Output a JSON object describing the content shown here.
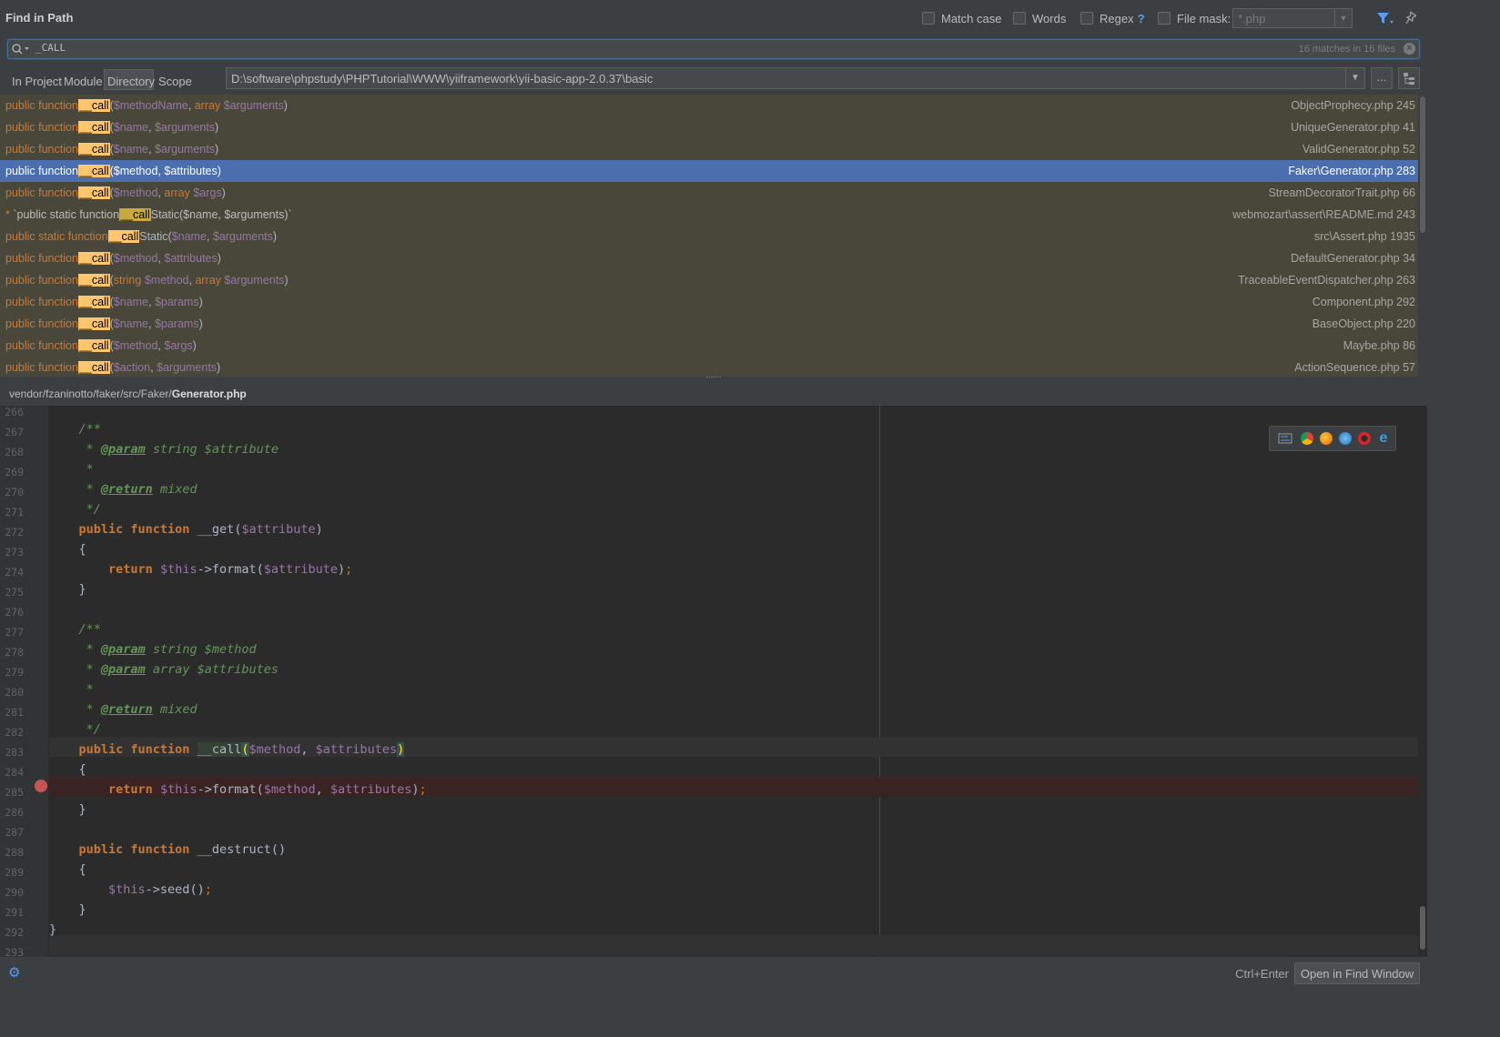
{
  "window": {
    "title": "Find in Path"
  },
  "options": {
    "match_case": "Match case",
    "words": "Words",
    "regex": "Regex",
    "regex_help": "?",
    "file_mask": "File mask:",
    "file_mask_value": "*.php"
  },
  "search": {
    "query": "_CALL",
    "count": "16 matches in 16 files"
  },
  "scope": {
    "in_project": "In Project",
    "module": "Module",
    "directory": "Directory",
    "scope": "Scope",
    "directory_path": "D:\\software\\phpstudy\\PHPTutorial\\WWW\\yiiframework\\yii-basic-app-2.0.37\\basic",
    "browse": "...",
    "recursive_icon": "tree-icon"
  },
  "results": [
    {
      "pre": "public function",
      "match": "__call",
      "args": "($methodName, array $arguments)",
      "file": "ObjectProphecy.php 245"
    },
    {
      "pre": "public function",
      "match": "__call",
      "args": "($name, $arguments)",
      "file": "UniqueGenerator.php 41"
    },
    {
      "pre": "public function",
      "match": "__call",
      "args": "($name, $arguments)",
      "file": "ValidGenerator.php 52"
    },
    {
      "pre": "public function",
      "match": "__call",
      "args": "($method, $attributes)",
      "file": "Faker\\Generator.php 283",
      "selected": true
    },
    {
      "pre": "public function",
      "match": "__call",
      "args": "($method, array $args)",
      "file": "StreamDecoratorTrait.php 66"
    },
    {
      "pre": "* `public static function",
      "match": "__call",
      "args": "Static($name, $arguments)`",
      "file": "webmozart\\assert\\README.md 243",
      "plain": true
    },
    {
      "pre": "public static function",
      "match": "__call",
      "args": "Static($name, $arguments)",
      "file": "src\\Assert.php 1935"
    },
    {
      "pre": "public function",
      "match": "__call",
      "args": "($method, $attributes)",
      "file": "DefaultGenerator.php 34"
    },
    {
      "pre": "public function",
      "match": "__call",
      "args": "(string $method, array $arguments)",
      "file": "TraceableEventDispatcher.php 263"
    },
    {
      "pre": "public function",
      "match": "__call",
      "args": "($name, $params)",
      "file": "Component.php 292"
    },
    {
      "pre": "public function",
      "match": "__call",
      "args": "($name, $params)",
      "file": "BaseObject.php 220"
    },
    {
      "pre": "public function",
      "match": "__call",
      "args": "($method, $args)",
      "file": "Maybe.php 86"
    },
    {
      "pre": "public function",
      "match": "__call",
      "args": "($action, $arguments)",
      "file": "ActionSequence.php 57"
    }
  ],
  "preview": {
    "path_prefix": "vendor/fzaninotto/faker/src/Faker/",
    "path_file": "Generator.php",
    "line_numbers": [
      "266",
      "267",
      "268",
      "269",
      "270",
      "271",
      "272",
      "273",
      "274",
      "275",
      "276",
      "277",
      "278",
      "279",
      "280",
      "281",
      "282",
      "283",
      "284",
      "285",
      "286",
      "287",
      "288",
      "289",
      "290",
      "291",
      "292",
      "293"
    ],
    "browser_icons": [
      "settings-icon",
      "chrome-icon",
      "firefox-icon",
      "safari-icon",
      "opera-icon",
      "ie-icon"
    ]
  },
  "footer": {
    "shortcut": "Ctrl+Enter",
    "open_button": "Open in Find Window"
  }
}
